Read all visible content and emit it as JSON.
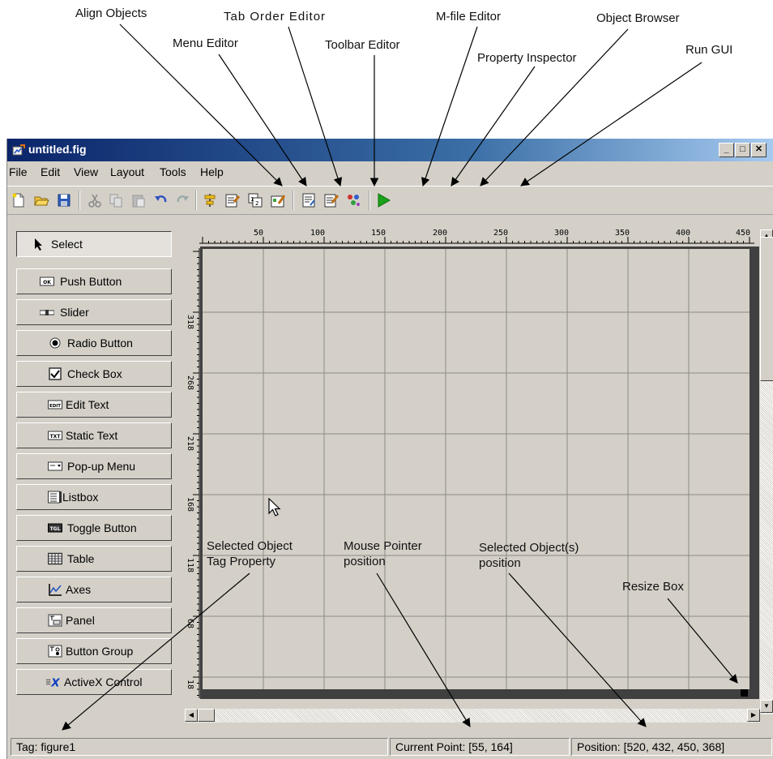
{
  "callouts": {
    "align_objects": "Align Objects",
    "menu_editor": "Menu Editor",
    "tab_order_editor": "Tab Order Editor",
    "toolbar_editor": "Toolbar Editor",
    "mfile_editor": "M-file Editor",
    "property_inspector": "Property Inspector",
    "object_browser": "Object Browser",
    "run_gui": "Run GUI",
    "selected_tag_line1": "Selected Object",
    "selected_tag_line2": "Tag Property",
    "mouse_pointer_line1": "Mouse Pointer",
    "mouse_pointer_line2": "position",
    "selected_pos_line1": "Selected Object(s)",
    "selected_pos_line2": "position",
    "resize_box": "Resize Box"
  },
  "window": {
    "title": "untitled.fig"
  },
  "menubar": {
    "items": [
      "File",
      "Edit",
      "View",
      "Layout",
      "Tools",
      "Help"
    ]
  },
  "toolbar": {
    "buttons": [
      "new-file-icon",
      "open-folder-icon",
      "save-icon",
      "cut-icon",
      "copy-icon",
      "paste-icon",
      "undo-icon",
      "redo-icon",
      "align-objects-icon",
      "menu-editor-icon",
      "tab-order-editor-icon",
      "toolbar-editor-icon",
      "mfile-editor-icon",
      "property-inspector-icon",
      "object-browser-icon",
      "run-gui-icon"
    ]
  },
  "palette": {
    "items": [
      "Select",
      "Push Button",
      "Slider",
      "Radio Button",
      "Check Box",
      "Edit Text",
      "Static Text",
      "Pop-up Menu",
      "Listbox",
      "Toggle Button",
      "Table",
      "Axes",
      "Panel",
      "Button Group",
      "ActiveX Control"
    ],
    "glyphs": {
      "push": "OK",
      "edit": "EDIT",
      "static": "TXT",
      "toggle": "TGL",
      "activex": "X"
    }
  },
  "rulers": {
    "top": [
      "50",
      "100",
      "150",
      "200",
      "250",
      "300",
      "350",
      "400",
      "450"
    ],
    "left": [
      "318",
      "268",
      "218",
      "168",
      "118",
      "68",
      "18"
    ]
  },
  "statusbar": {
    "tag": "Tag: figure1",
    "current_point": "Current Point:  [55, 164]",
    "position": "Position: [520, 432, 450, 368]"
  },
  "colors": {
    "title_start": "#0a246a",
    "title_end": "#a6caf0",
    "face": "#d4d0c8",
    "run_green": "#1aa21a"
  }
}
